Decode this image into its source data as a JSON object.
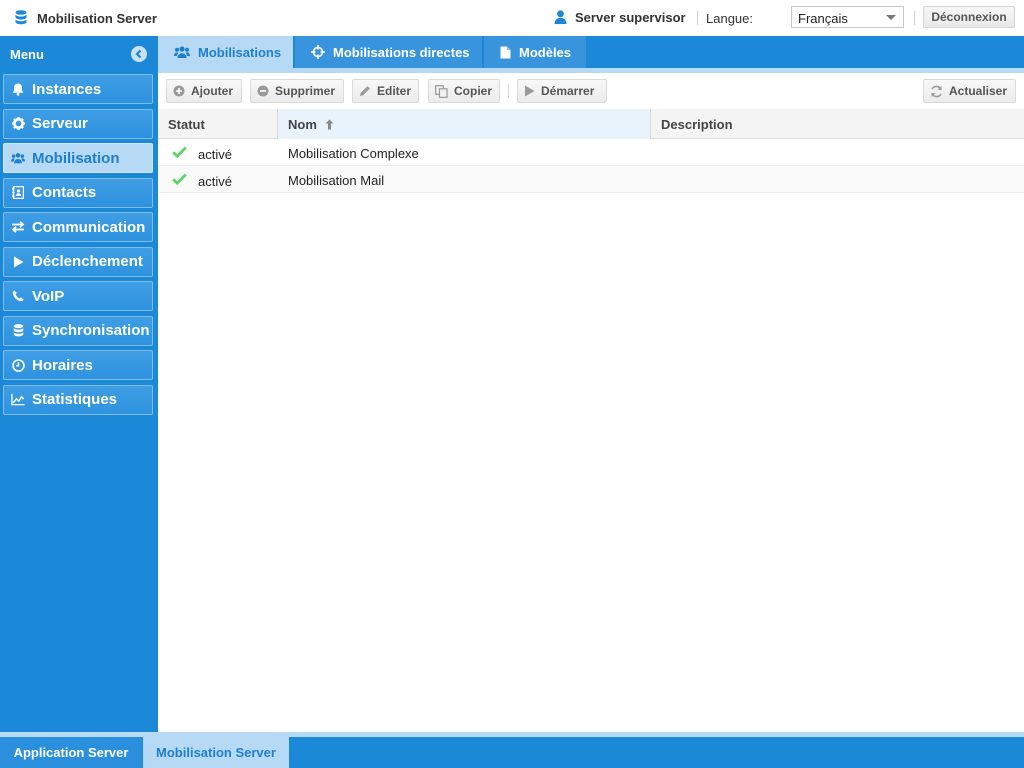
{
  "header": {
    "app_title": "Mobilisation Server",
    "app_icon": "database-icon",
    "user_name": "Server supervisor",
    "user_icon": "user-icon",
    "language_label": "Langue:",
    "language_value": "Français",
    "logout_label": "Déconnexion"
  },
  "sidebar": {
    "title": "Menu",
    "collapse_icon": "chevron-left-circle-icon",
    "items": [
      {
        "label": "Instances",
        "icon": "bell-icon",
        "active": false
      },
      {
        "label": "Serveur",
        "icon": "gear-icon",
        "active": false
      },
      {
        "label": "Mobilisation",
        "icon": "users-icon",
        "active": true
      },
      {
        "label": "Contacts",
        "icon": "address-book-icon",
        "active": false
      },
      {
        "label": "Communication",
        "icon": "exchange-icon",
        "active": false
      },
      {
        "label": "Déclenchement",
        "icon": "play-icon",
        "active": false
      },
      {
        "label": "VoIP",
        "icon": "phone-icon",
        "active": false
      },
      {
        "label": "Synchronisation",
        "icon": "database-icon",
        "active": false
      },
      {
        "label": "Horaires",
        "icon": "clock-icon",
        "active": false
      },
      {
        "label": "Statistiques",
        "icon": "chart-line-icon",
        "active": false
      }
    ]
  },
  "tabs": [
    {
      "label": "Mobilisations",
      "icon": "users-icon",
      "active": true
    },
    {
      "label": "Mobilisations directes",
      "icon": "crosshairs-icon",
      "active": false
    },
    {
      "label": "Modèles",
      "icon": "file-icon",
      "active": false
    }
  ],
  "toolbar": {
    "add_label": "Ajouter",
    "delete_label": "Supprimer",
    "edit_label": "Editer",
    "copy_label": "Copier",
    "start_label": "Démarrer",
    "refresh_label": "Actualiser"
  },
  "grid": {
    "columns": [
      "Statut",
      "Nom",
      "Description"
    ],
    "sort": {
      "column": "Nom",
      "direction": "ascending"
    },
    "rows": [
      {
        "status": "activé",
        "name": "Mobilisation Complexe",
        "description": ""
      },
      {
        "status": "activé",
        "name": "Mobilisation Mail",
        "description": ""
      }
    ]
  },
  "footer": {
    "tabs": [
      {
        "label": "Application Server",
        "active": false
      },
      {
        "label": "Mobilisation Server",
        "active": true
      }
    ]
  },
  "colors": {
    "primary": "#1c88d8",
    "active_tab": "#b6d9f5",
    "active_text": "#1f7fcf",
    "status_ok": "#5dd36a"
  }
}
